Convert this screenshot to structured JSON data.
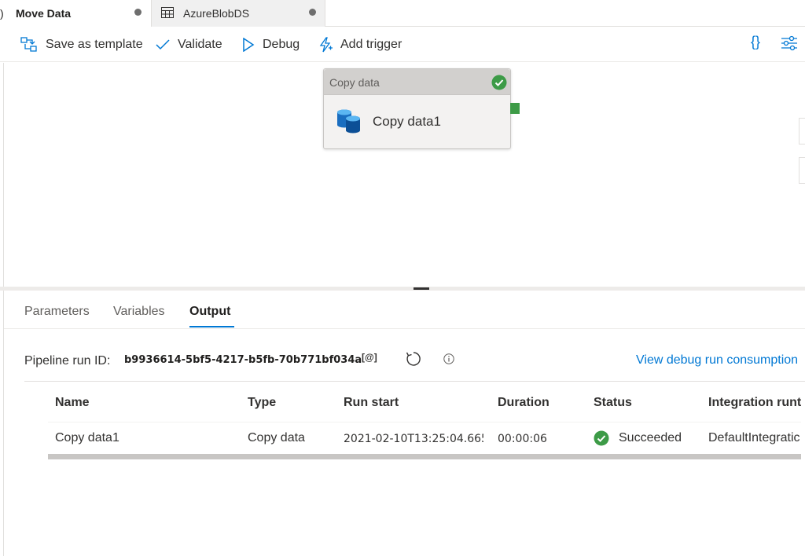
{
  "tabs": [
    {
      "label": "Move Data",
      "edge_glyph": ")"
    },
    {
      "label": "AzureBlobDS"
    }
  ],
  "toolbar": {
    "save_template": "Save as template",
    "validate": "Validate",
    "debug": "Debug",
    "add_trigger": "Add trigger",
    "code_glyph": "{}"
  },
  "activity": {
    "type": "Copy data",
    "name": "Copy data1"
  },
  "panel": {
    "tabs": [
      "Parameters",
      "Variables",
      "Output"
    ],
    "active_tab": "Output",
    "run_label": "Pipeline run ID:",
    "run_id": "b9936614-5bf5-4217-b5fb-70b771bf034a",
    "copy_glyph": "[@]",
    "consumption_link": "View debug run consumption",
    "columns": [
      "Name",
      "Type",
      "Run start",
      "Duration",
      "Status",
      "Integration runt"
    ],
    "rows": [
      {
        "name": "Copy data1",
        "type": "Copy data",
        "run_start": "2021-02-10T13:25:04.665",
        "duration": "00:00:06",
        "status": "Succeeded",
        "integration_runtime": "DefaultIntegratic"
      }
    ]
  },
  "colors": {
    "accent": "#0078d4",
    "success": "#3d9b47"
  }
}
